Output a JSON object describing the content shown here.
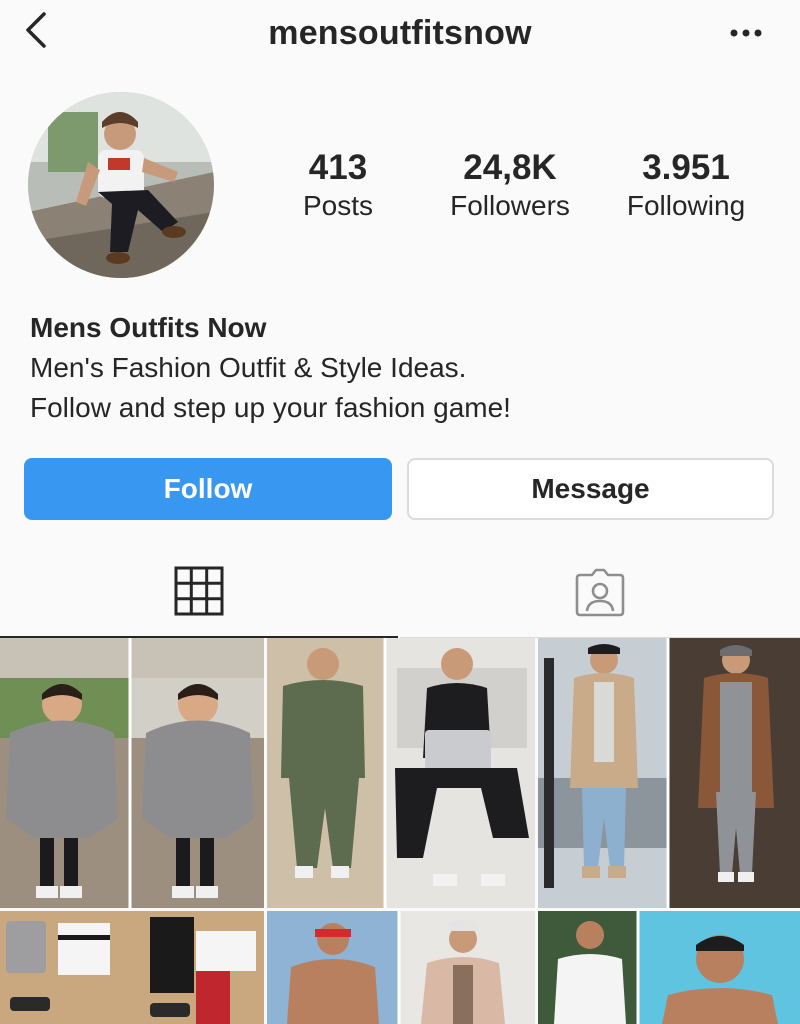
{
  "header": {
    "username": "mensoutfitsnow",
    "back_icon": "chevron-left-icon",
    "more_icon": "more-horizontal-icon"
  },
  "profile": {
    "stats": {
      "posts": {
        "count": "413",
        "label": "Posts"
      },
      "followers": {
        "count": "24,8K",
        "label": "Followers"
      },
      "following": {
        "count": "3.951",
        "label": "Following"
      }
    },
    "display_name": "Mens Outfits Now",
    "bio": [
      "Men's Fashion Outfit & Style Ideas.",
      "Follow and step up your fashion game!"
    ]
  },
  "actions": {
    "follow_label": "Follow",
    "message_label": "Message"
  },
  "tabs": {
    "active": "grid",
    "items": [
      "grid-icon",
      "tagged-person-icon"
    ]
  },
  "colors": {
    "accent": "#3897f0",
    "text": "#262626",
    "border": "#dbdbdb",
    "background": "#fafafa"
  },
  "posts_grid": [
    {
      "description": "boy in grey scarf"
    },
    {
      "description": "man in green tracksuit"
    },
    {
      "description": "man with laptop"
    },
    {
      "description": "man in camel coat"
    },
    {
      "description": "man in grey outfit with brown coat"
    },
    {
      "description": "flatlay outfits"
    },
    {
      "description": "man with red bandana"
    },
    {
      "description": "man in white shirt"
    }
  ]
}
